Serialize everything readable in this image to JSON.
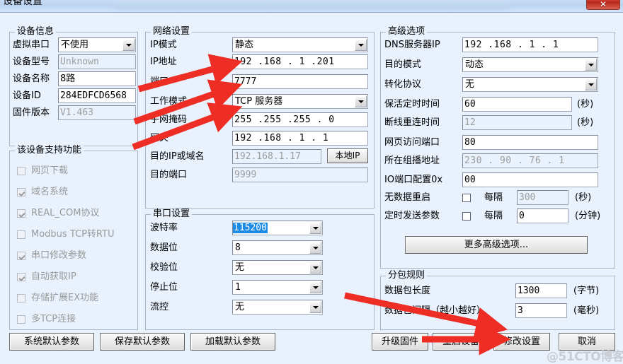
{
  "window": {
    "title": "设备设置",
    "close_label": "✕"
  },
  "device_info": {
    "legend": "设备信息",
    "virtual_com_label": "虚拟串口",
    "virtual_com_value": "不使用",
    "model_label": "设备型号",
    "model_value": "Unknown",
    "name_label": "设备名称",
    "name_value": "8路",
    "id_label": "设备ID",
    "id_value": "284EDFCD6568",
    "firmware_label": "固件版本",
    "firmware_value": "V1.463"
  },
  "supported": {
    "legend": "该设备支持功能",
    "items": [
      {
        "label": "网页下载",
        "checked": false
      },
      {
        "label": "域名系统",
        "checked": true
      },
      {
        "label": "REAL_COM协议",
        "checked": true
      },
      {
        "label": "Modbus TCP转RTU",
        "checked": false
      },
      {
        "label": "串口修改参数",
        "checked": true
      },
      {
        "label": "自动获取IP",
        "checked": true
      },
      {
        "label": "存储扩展EX功能",
        "checked": false
      },
      {
        "label": "多TCP连接",
        "checked": false
      }
    ]
  },
  "network": {
    "legend": "网络设置",
    "ip_mode_label": "IP模式",
    "ip_mode_value": "静态",
    "ip_addr_label": "IP地址",
    "ip_addr_value": "192 .168 .  1  .201",
    "port_label": "端口",
    "port_value": "7777",
    "work_mode_label": "工作模式",
    "work_mode_value": "TCP 服务器",
    "netmask_label": "子网掩码",
    "netmask_value": "255 .255 .255 .  0",
    "gateway_label": "网关",
    "gateway_value": "192 .168 .  1  .  1",
    "dest_ip_label": "目的IP或域名",
    "dest_ip_value": "192.168.1.17",
    "local_ip_button": "本地IP",
    "dest_port_label": "目的端口",
    "dest_port_value": "9999"
  },
  "serial": {
    "legend": "串口设置",
    "baud_label": "波特率",
    "baud_value": "115200",
    "data_bits_label": "数据位",
    "data_bits_value": "8",
    "parity_label": "校验位",
    "parity_value": "无",
    "stop_bits_label": "停止位",
    "stop_bits_value": "1",
    "flow_label": "流控",
    "flow_value": "无"
  },
  "advanced": {
    "legend": "高级选项",
    "dns_label": "DNS服务器IP",
    "dns_value": "192 .168 .  1  .  1",
    "dest_mode_label": "目的模式",
    "dest_mode_value": "动态",
    "protocol_label": "转化协议",
    "protocol_value": "无",
    "keepalive_label": "保活定时时间",
    "keepalive_value": "60",
    "keepalive_unit": "(秒)",
    "reconnect_label": "断线重连时间",
    "reconnect_value": "12",
    "reconnect_unit": "(秒)",
    "web_port_label": "网页访问端口",
    "web_port_value": "80",
    "multicast_label": "所在组播地址",
    "multicast_value": "230 . 90 . 76 .  1",
    "io_label": "IO端口配置0x",
    "io_value": "00",
    "nodata_reboot_label": "无数据重启",
    "nodata_interval_label": "每隔",
    "nodata_interval_value": "300",
    "nodata_unit": "(秒)",
    "nodata_checked": false,
    "timed_send_label": "定时发送参数",
    "timed_interval_label": "每隔",
    "timed_interval_value": "0",
    "timed_unit": "(分钟)",
    "timed_checked": false,
    "more_button": "更多高级选项..."
  },
  "packet": {
    "legend": "分包规则",
    "length_label": "数据包长度",
    "length_value": "1300",
    "length_unit": "(字节)",
    "interval_label": "数据包间隔（越小越好）",
    "interval_value": "3",
    "interval_unit": "(毫秒)"
  },
  "footer": {
    "system_default": "系统默认参数",
    "save_default": "保存默认参数",
    "load_default": "加载默认参数",
    "upgrade_firmware": "升级固件",
    "reboot_device": "重启设备",
    "apply_settings": "修改设置",
    "cancel": "取消"
  },
  "watermark": "@51CTO博客",
  "colors": {
    "background": "#e9f1fd",
    "accent_red": "#ee2d24",
    "selection_blue": "#1a8ce8"
  }
}
